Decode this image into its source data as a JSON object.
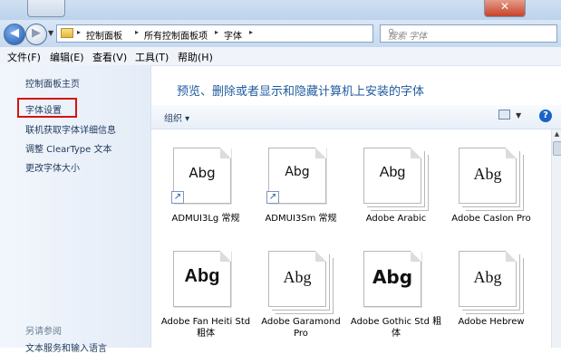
{
  "window": {
    "close_glyph": "✕"
  },
  "address": {
    "breadcrumbs": [
      "控制面板",
      "所有控制面板项",
      "字体"
    ]
  },
  "search": {
    "placeholder": "搜索 字体"
  },
  "menu": {
    "items": [
      "文件(F)",
      "编辑(E)",
      "查看(V)",
      "工具(T)",
      "帮助(H)"
    ]
  },
  "sidebar": {
    "items": [
      "控制面板主页",
      "字体设置",
      "联机获取字体详细信息",
      "调整 ClearType 文本",
      "更改字体大小"
    ],
    "see_also": "另请参阅",
    "see_also_link": "文本服务和输入语言"
  },
  "main": {
    "heading": "预览、删除或者显示和隐藏计算机上安装的字体",
    "organize_label": "组织 ▾",
    "help_glyph": "?"
  },
  "fonts": [
    {
      "preview": "Abg",
      "name": "ADMUI3Lg 常规",
      "shortcut": true,
      "stacked": false
    },
    {
      "preview": "Abg",
      "name": "ADMUI3Sm 常规",
      "shortcut": true,
      "stacked": false
    },
    {
      "preview": "Abg",
      "name": "Adobe Arabic",
      "shortcut": false,
      "stacked": true
    },
    {
      "preview": "Abg",
      "name": "Adobe Caslon Pro",
      "shortcut": false,
      "stacked": true
    },
    {
      "preview": "Abg",
      "name": "Adobe Fan Heiti Std 粗体",
      "shortcut": false,
      "stacked": false
    },
    {
      "preview": "Abg",
      "name": "Adobe Garamond Pro",
      "shortcut": false,
      "stacked": true
    },
    {
      "preview": "Abg",
      "name": "Adobe Gothic Std 粗体",
      "shortcut": false,
      "stacked": false
    },
    {
      "preview": "Abg",
      "name": "Adobe Hebrew",
      "shortcut": false,
      "stacked": true
    }
  ]
}
